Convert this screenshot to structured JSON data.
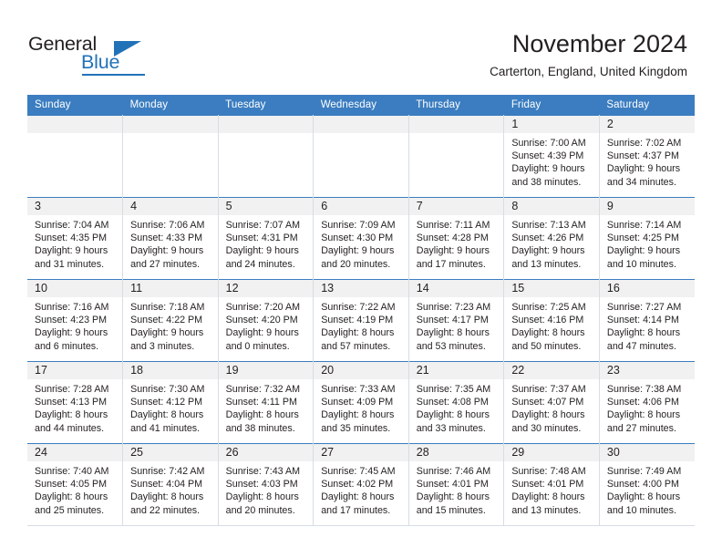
{
  "brand": {
    "word_one": "General",
    "word_two": "Blue",
    "triangle_icon": "brand-triangle-icon",
    "accent_color": "#2272b8"
  },
  "header": {
    "title": "November 2024",
    "location": "Carterton, England, United Kingdom"
  },
  "calendar": {
    "header_background": "#3b7dc0",
    "daynum_background": "#f1f1f1",
    "weekday_headers": [
      "Sunday",
      "Monday",
      "Tuesday",
      "Wednesday",
      "Thursday",
      "Friday",
      "Saturday"
    ],
    "weeks": [
      [
        {
          "day": "",
          "empty": true,
          "sunrise": "",
          "sunset": "",
          "daylight_line1": "",
          "daylight_line2": ""
        },
        {
          "day": "",
          "empty": true,
          "sunrise": "",
          "sunset": "",
          "daylight_line1": "",
          "daylight_line2": ""
        },
        {
          "day": "",
          "empty": true,
          "sunrise": "",
          "sunset": "",
          "daylight_line1": "",
          "daylight_line2": ""
        },
        {
          "day": "",
          "empty": true,
          "sunrise": "",
          "sunset": "",
          "daylight_line1": "",
          "daylight_line2": ""
        },
        {
          "day": "",
          "empty": true,
          "sunrise": "",
          "sunset": "",
          "daylight_line1": "",
          "daylight_line2": ""
        },
        {
          "day": "1",
          "empty": false,
          "sunrise": "Sunrise: 7:00 AM",
          "sunset": "Sunset: 4:39 PM",
          "daylight_line1": "Daylight: 9 hours",
          "daylight_line2": "and 38 minutes."
        },
        {
          "day": "2",
          "empty": false,
          "sunrise": "Sunrise: 7:02 AM",
          "sunset": "Sunset: 4:37 PM",
          "daylight_line1": "Daylight: 9 hours",
          "daylight_line2": "and 34 minutes."
        }
      ],
      [
        {
          "day": "3",
          "empty": false,
          "sunrise": "Sunrise: 7:04 AM",
          "sunset": "Sunset: 4:35 PM",
          "daylight_line1": "Daylight: 9 hours",
          "daylight_line2": "and 31 minutes."
        },
        {
          "day": "4",
          "empty": false,
          "sunrise": "Sunrise: 7:06 AM",
          "sunset": "Sunset: 4:33 PM",
          "daylight_line1": "Daylight: 9 hours",
          "daylight_line2": "and 27 minutes."
        },
        {
          "day": "5",
          "empty": false,
          "sunrise": "Sunrise: 7:07 AM",
          "sunset": "Sunset: 4:31 PM",
          "daylight_line1": "Daylight: 9 hours",
          "daylight_line2": "and 24 minutes."
        },
        {
          "day": "6",
          "empty": false,
          "sunrise": "Sunrise: 7:09 AM",
          "sunset": "Sunset: 4:30 PM",
          "daylight_line1": "Daylight: 9 hours",
          "daylight_line2": "and 20 minutes."
        },
        {
          "day": "7",
          "empty": false,
          "sunrise": "Sunrise: 7:11 AM",
          "sunset": "Sunset: 4:28 PM",
          "daylight_line1": "Daylight: 9 hours",
          "daylight_line2": "and 17 minutes."
        },
        {
          "day": "8",
          "empty": false,
          "sunrise": "Sunrise: 7:13 AM",
          "sunset": "Sunset: 4:26 PM",
          "daylight_line1": "Daylight: 9 hours",
          "daylight_line2": "and 13 minutes."
        },
        {
          "day": "9",
          "empty": false,
          "sunrise": "Sunrise: 7:14 AM",
          "sunset": "Sunset: 4:25 PM",
          "daylight_line1": "Daylight: 9 hours",
          "daylight_line2": "and 10 minutes."
        }
      ],
      [
        {
          "day": "10",
          "empty": false,
          "sunrise": "Sunrise: 7:16 AM",
          "sunset": "Sunset: 4:23 PM",
          "daylight_line1": "Daylight: 9 hours",
          "daylight_line2": "and 6 minutes."
        },
        {
          "day": "11",
          "empty": false,
          "sunrise": "Sunrise: 7:18 AM",
          "sunset": "Sunset: 4:22 PM",
          "daylight_line1": "Daylight: 9 hours",
          "daylight_line2": "and 3 minutes."
        },
        {
          "day": "12",
          "empty": false,
          "sunrise": "Sunrise: 7:20 AM",
          "sunset": "Sunset: 4:20 PM",
          "daylight_line1": "Daylight: 9 hours",
          "daylight_line2": "and 0 minutes."
        },
        {
          "day": "13",
          "empty": false,
          "sunrise": "Sunrise: 7:22 AM",
          "sunset": "Sunset: 4:19 PM",
          "daylight_line1": "Daylight: 8 hours",
          "daylight_line2": "and 57 minutes."
        },
        {
          "day": "14",
          "empty": false,
          "sunrise": "Sunrise: 7:23 AM",
          "sunset": "Sunset: 4:17 PM",
          "daylight_line1": "Daylight: 8 hours",
          "daylight_line2": "and 53 minutes."
        },
        {
          "day": "15",
          "empty": false,
          "sunrise": "Sunrise: 7:25 AM",
          "sunset": "Sunset: 4:16 PM",
          "daylight_line1": "Daylight: 8 hours",
          "daylight_line2": "and 50 minutes."
        },
        {
          "day": "16",
          "empty": false,
          "sunrise": "Sunrise: 7:27 AM",
          "sunset": "Sunset: 4:14 PM",
          "daylight_line1": "Daylight: 8 hours",
          "daylight_line2": "and 47 minutes."
        }
      ],
      [
        {
          "day": "17",
          "empty": false,
          "sunrise": "Sunrise: 7:28 AM",
          "sunset": "Sunset: 4:13 PM",
          "daylight_line1": "Daylight: 8 hours",
          "daylight_line2": "and 44 minutes."
        },
        {
          "day": "18",
          "empty": false,
          "sunrise": "Sunrise: 7:30 AM",
          "sunset": "Sunset: 4:12 PM",
          "daylight_line1": "Daylight: 8 hours",
          "daylight_line2": "and 41 minutes."
        },
        {
          "day": "19",
          "empty": false,
          "sunrise": "Sunrise: 7:32 AM",
          "sunset": "Sunset: 4:11 PM",
          "daylight_line1": "Daylight: 8 hours",
          "daylight_line2": "and 38 minutes."
        },
        {
          "day": "20",
          "empty": false,
          "sunrise": "Sunrise: 7:33 AM",
          "sunset": "Sunset: 4:09 PM",
          "daylight_line1": "Daylight: 8 hours",
          "daylight_line2": "and 35 minutes."
        },
        {
          "day": "21",
          "empty": false,
          "sunrise": "Sunrise: 7:35 AM",
          "sunset": "Sunset: 4:08 PM",
          "daylight_line1": "Daylight: 8 hours",
          "daylight_line2": "and 33 minutes."
        },
        {
          "day": "22",
          "empty": false,
          "sunrise": "Sunrise: 7:37 AM",
          "sunset": "Sunset: 4:07 PM",
          "daylight_line1": "Daylight: 8 hours",
          "daylight_line2": "and 30 minutes."
        },
        {
          "day": "23",
          "empty": false,
          "sunrise": "Sunrise: 7:38 AM",
          "sunset": "Sunset: 4:06 PM",
          "daylight_line1": "Daylight: 8 hours",
          "daylight_line2": "and 27 minutes."
        }
      ],
      [
        {
          "day": "24",
          "empty": false,
          "sunrise": "Sunrise: 7:40 AM",
          "sunset": "Sunset: 4:05 PM",
          "daylight_line1": "Daylight: 8 hours",
          "daylight_line2": "and 25 minutes."
        },
        {
          "day": "25",
          "empty": false,
          "sunrise": "Sunrise: 7:42 AM",
          "sunset": "Sunset: 4:04 PM",
          "daylight_line1": "Daylight: 8 hours",
          "daylight_line2": "and 22 minutes."
        },
        {
          "day": "26",
          "empty": false,
          "sunrise": "Sunrise: 7:43 AM",
          "sunset": "Sunset: 4:03 PM",
          "daylight_line1": "Daylight: 8 hours",
          "daylight_line2": "and 20 minutes."
        },
        {
          "day": "27",
          "empty": false,
          "sunrise": "Sunrise: 7:45 AM",
          "sunset": "Sunset: 4:02 PM",
          "daylight_line1": "Daylight: 8 hours",
          "daylight_line2": "and 17 minutes."
        },
        {
          "day": "28",
          "empty": false,
          "sunrise": "Sunrise: 7:46 AM",
          "sunset": "Sunset: 4:01 PM",
          "daylight_line1": "Daylight: 8 hours",
          "daylight_line2": "and 15 minutes."
        },
        {
          "day": "29",
          "empty": false,
          "sunrise": "Sunrise: 7:48 AM",
          "sunset": "Sunset: 4:01 PM",
          "daylight_line1": "Daylight: 8 hours",
          "daylight_line2": "and 13 minutes."
        },
        {
          "day": "30",
          "empty": false,
          "sunrise": "Sunrise: 7:49 AM",
          "sunset": "Sunset: 4:00 PM",
          "daylight_line1": "Daylight: 8 hours",
          "daylight_line2": "and 10 minutes."
        }
      ]
    ]
  }
}
